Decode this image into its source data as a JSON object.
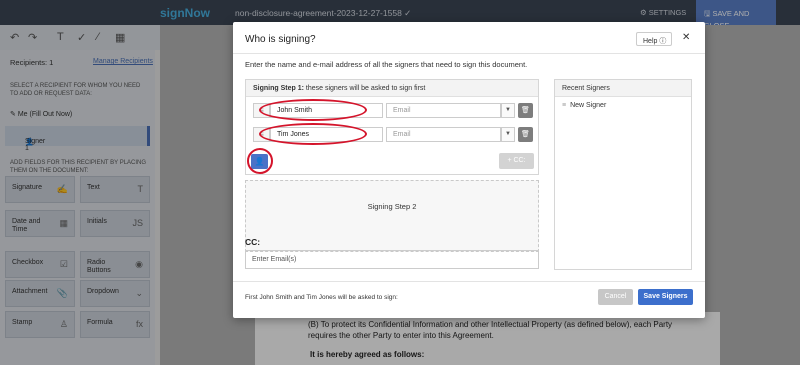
{
  "app": {
    "logo": "signNow",
    "doc_title": "non-disclosure-agreement-2023-12-27-1558 ✓",
    "settings_label": "⚙ SETTINGS",
    "save_close_label": "🖫 SAVE AND CLOSE"
  },
  "toolbar": {
    "undo": "↶",
    "redo": "↷",
    "text_tool": "T",
    "check_tool": "✓",
    "line_tool": "⁄",
    "date_tool": "▦"
  },
  "sidebar": {
    "recipients_label": "Recipients: 1",
    "manage_label": "Manage Recipients",
    "select_note": "SELECT A RECIPIENT FOR WHOM YOU NEED TO ADD OR REQUEST DATA:",
    "me_label": "Me (Fill Out Now)",
    "signer_label": "Signer 1",
    "fields_note": "ADD FIELDS FOR THIS RECIPIENT BY PLACING THEM ON THE DOCUMENT:",
    "fields": [
      {
        "label": "Signature",
        "icon": "✍"
      },
      {
        "label": "Text",
        "icon": "T"
      },
      {
        "label": "Date and Time",
        "icon": "▦"
      },
      {
        "label": "Initials",
        "icon": "JS"
      },
      {
        "label": "Checkbox",
        "icon": "☑"
      },
      {
        "label": "Radio Buttons",
        "icon": "◉"
      },
      {
        "label": "Attachment",
        "icon": "📎"
      },
      {
        "label": "Dropdown",
        "icon": "⌄"
      },
      {
        "label": "Stamp",
        "icon": "♙"
      },
      {
        "label": "Formula",
        "icon": "fx"
      }
    ]
  },
  "document": {
    "para_b": "(B)      To protect its Confidential Information and other Intellectual Property (as defined below), each Party requires the other Party to enter into this Agreement.",
    "agreed": "It is hereby agreed as follows:"
  },
  "modal": {
    "title": "Who is signing?",
    "help_label": "Help ⓘ",
    "close_icon": "✕",
    "description": "Enter the name and e-mail address of all the signers that need to sign this document.",
    "step1_label": "Signing Step 1:",
    "step1_desc": "these signers will be asked to sign first",
    "signers": [
      {
        "name": "John Smith",
        "email_placeholder": "Email"
      },
      {
        "name": "Tim Jones",
        "email_placeholder": "Email"
      }
    ],
    "cc_button": "+ CC:",
    "step2_label": "Signing Step 2",
    "cc_label": "CC:",
    "cc_placeholder": "Enter Email(s)",
    "recent_title": "Recent Signers",
    "recent_items": [
      "New Signer"
    ],
    "footer_note": "First John Smith and Tim Jones will be asked to sign:",
    "cancel_label": "Cancel",
    "save_label": "Save Signers"
  },
  "annotation_color": "#d4142b"
}
